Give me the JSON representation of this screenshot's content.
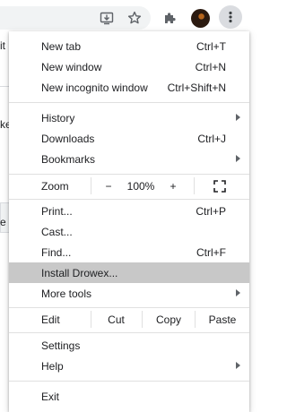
{
  "page_fragments": {
    "frag1": "it",
    "frag2": "ke",
    "frag3": "e"
  },
  "menu": {
    "group1": [
      {
        "label": "New tab",
        "shortcut": "Ctrl+T"
      },
      {
        "label": "New window",
        "shortcut": "Ctrl+N"
      },
      {
        "label": "New incognito window",
        "shortcut": "Ctrl+Shift+N"
      }
    ],
    "group2": [
      {
        "label": "History",
        "shortcut": ""
      },
      {
        "label": "Downloads",
        "shortcut": "Ctrl+J"
      },
      {
        "label": "Bookmarks",
        "shortcut": ""
      }
    ],
    "zoom": {
      "label": "Zoom",
      "minus": "−",
      "level": "100%",
      "plus": "+"
    },
    "group3": [
      {
        "label": "Print...",
        "shortcut": "Ctrl+P"
      },
      {
        "label": "Cast...",
        "shortcut": ""
      },
      {
        "label": "Find...",
        "shortcut": "Ctrl+F"
      },
      {
        "label": "Install Drowex...",
        "shortcut": ""
      },
      {
        "label": "More tools",
        "shortcut": ""
      }
    ],
    "edit": {
      "label": "Edit",
      "cut": "Cut",
      "copy": "Copy",
      "paste": "Paste"
    },
    "group4": [
      {
        "label": "Settings",
        "shortcut": ""
      },
      {
        "label": "Help",
        "shortcut": ""
      }
    ],
    "exit": {
      "label": "Exit"
    }
  },
  "colors": {
    "highlight": "#c8c8c8",
    "menu_button_bg": "#dadce0"
  },
  "icons": [
    "install-app-icon",
    "bookmark-star-icon",
    "extensions-puzzle-icon",
    "profile-avatar",
    "three-dot-menu-icon",
    "fullscreen-icon",
    "submenu-arrow-icon"
  ]
}
